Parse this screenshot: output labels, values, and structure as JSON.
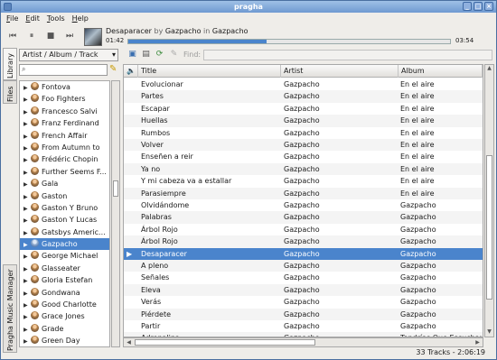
{
  "window": {
    "title": "pragha"
  },
  "menubar": {
    "file": "ile",
    "file_u": "F",
    "edit": "dit",
    "edit_u": "E",
    "tools": "ools",
    "tools_u": "T",
    "help": "elp",
    "help_u": "H"
  },
  "player": {
    "track_title": "Desaparacer",
    "by_word": "by",
    "artist": "Gazpacho",
    "in_word": "in",
    "album": "Gazpacho",
    "time_current": "01:42",
    "time_total": "03:54",
    "progress_percent": 43
  },
  "side_tabs": {
    "library": "Library",
    "files": "Files",
    "manager": "Pragha Music Manager"
  },
  "library": {
    "view_mode": "Artist / Album / Track",
    "search_value": "",
    "artists": [
      "Fontova",
      "Foo Fighters",
      "Francesco Salvi",
      "Franz Ferdinand",
      "French Affair",
      "From Autumn to",
      "Frédéric Chopin",
      "Further Seems F...",
      "Gala",
      "Gaston",
      "Gaston Y Bruno",
      "Gaston Y Lucas",
      "Gatsbys Americ...",
      "Gazpacho",
      "George Michael",
      "Glasseater",
      "Gloria Estefan",
      "Gondwana",
      "Good Charlotte",
      "Grace Jones",
      "Grade",
      "Green Day"
    ],
    "selected_index": 13
  },
  "playlist_toolbar": {
    "find_label": "Find:",
    "find_value": ""
  },
  "playlist": {
    "headers": {
      "title": "Title",
      "artist": "Artist",
      "album": "Album"
    },
    "rows": [
      [
        "Evolucionar",
        "Gazpacho",
        "En el aire"
      ],
      [
        "Partes",
        "Gazpacho",
        "En el aire"
      ],
      [
        "Escapar",
        "Gazpacho",
        "En el aire"
      ],
      [
        "Huellas",
        "Gazpacho",
        "En el aire"
      ],
      [
        "Rumbos",
        "Gazpacho",
        "En el aire"
      ],
      [
        "Volver",
        "Gazpacho",
        "En el aire"
      ],
      [
        "Enseñen a reir",
        "Gazpacho",
        "En el aire"
      ],
      [
        "Ya no",
        "Gazpacho",
        "En el aire"
      ],
      [
        "Y mi cabeza va a estallar",
        "Gazpacho",
        "En el aire"
      ],
      [
        "Parasiempre",
        "Gazpacho",
        "En el aire"
      ],
      [
        "Olvidándome",
        "Gazpacho",
        "Gazpacho"
      ],
      [
        "Palabras",
        "Gazpacho",
        "Gazpacho"
      ],
      [
        "Árbol Rojo",
        "Gazpacho",
        "Gazpacho"
      ],
      [
        "Árbol Rojo",
        "Gazpacho",
        "Gazpacho"
      ],
      [
        "Desaparacer",
        "Gazpacho",
        "Gazpacho"
      ],
      [
        "A pleno",
        "Gazpacho",
        "Gazpacho"
      ],
      [
        "Señales",
        "Gazpacho",
        "Gazpacho"
      ],
      [
        "Eleva",
        "Gazpacho",
        "Gazpacho"
      ],
      [
        "Verás",
        "Gazpacho",
        "Gazpacho"
      ],
      [
        "Piérdete",
        "Gazpacho",
        "Gazpacho"
      ],
      [
        "Partir",
        "Gazpacho",
        "Gazpacho"
      ],
      [
        "Adrenalina",
        "Gazpacho",
        "Tendrías Que Escuchar"
      ]
    ],
    "playing_index": 14
  },
  "status": {
    "text": "33 Tracks - 2:06:19"
  },
  "colors": {
    "selection": "#4a84cc",
    "titlebar": "#7fa6d8"
  }
}
